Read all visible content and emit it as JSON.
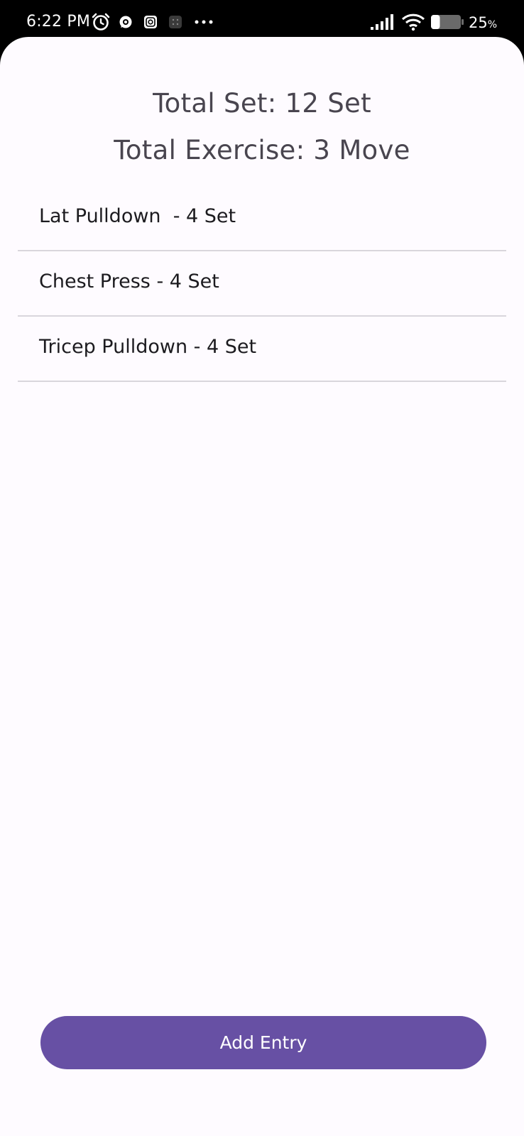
{
  "status_bar": {
    "time": "6:22 PM",
    "battery_value": "25",
    "battery_unit": "%",
    "battery_level": 0.25,
    "icons": [
      "alarm-icon",
      "whatsapp-icon",
      "instagram-icon",
      "grid-icon",
      "more-dots-icon",
      "signal-icon",
      "wifi-icon",
      "battery-icon"
    ]
  },
  "summary": {
    "total_set": "Total Set: 12 Set",
    "total_exercise": "Total Exercise: 3 Move"
  },
  "exercises": [
    {
      "text": "Lat Pulldown  - 4 Set"
    },
    {
      "text": "Chest Press - 4 Set"
    },
    {
      "text": "Tricep Pulldown - 4 Set"
    }
  ],
  "actions": {
    "add_entry_label": "Add Entry"
  },
  "colors": {
    "primary": "#6750a4",
    "background": "#fefbff",
    "divider": "#d9d6dc",
    "summary_text": "#49454f"
  }
}
